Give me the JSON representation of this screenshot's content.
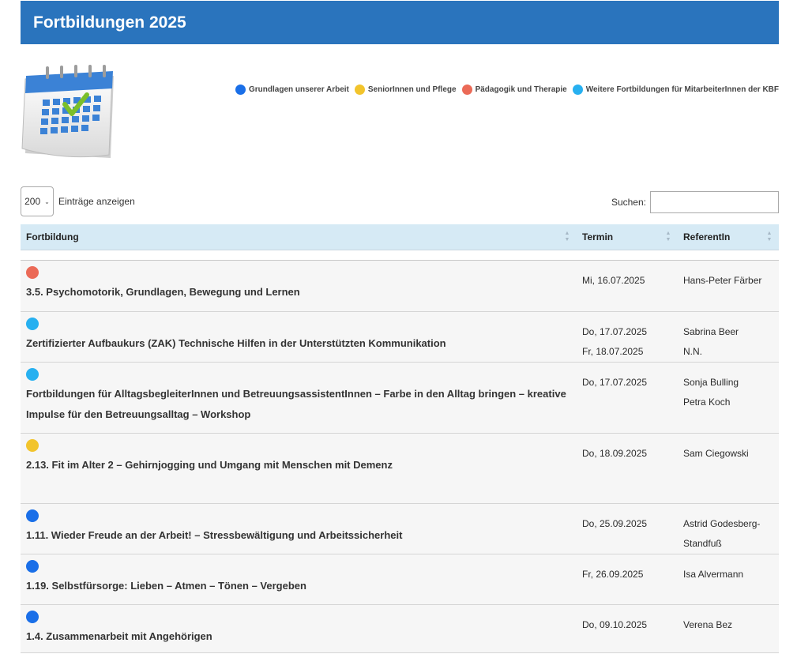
{
  "page_title": "Fortbildungen 2025",
  "legend": [
    {
      "label": "Grundlagen unserer Arbeit",
      "color": "#1a6fe8"
    },
    {
      "label": "SeniorInnen und Pflege",
      "color": "#f2c42c"
    },
    {
      "label": "Pädagogik und Therapie",
      "color": "#eb6a57"
    },
    {
      "label": "Weitere Fortbildungen für MitarbeiterInnen der KBF",
      "color": "#27b0f0"
    }
  ],
  "controls": {
    "page_length_value": "200",
    "page_length_label": "Einträge anzeigen",
    "search_label": "Suchen:",
    "search_value": ""
  },
  "table": {
    "headers": [
      "Fortbildung",
      "Termin",
      "ReferentIn"
    ],
    "rows": [
      {
        "color": "#eb6a57",
        "title": "3.5. Psychomotorik, Grundlagen, Bewegung und Lernen",
        "dates": [
          "Mi, 16.07.2025"
        ],
        "speakers": [
          "Hans-Peter Färber"
        ]
      },
      {
        "color": "#27b0f0",
        "title": "Zertifizierter Aufbaukurs (ZAK) Technische Hilfen in der Unterstützten Kommunikation",
        "dates": [
          "Do, 17.07.2025",
          "Fr, 18.07.2025"
        ],
        "speakers": [
          "Sabrina Beer",
          "N.N."
        ]
      },
      {
        "color": "#27b0f0",
        "title": "Fortbildungen für AlltagsbegleiterInnen und BetreuungsassistentInnen – Farbe in den Alltag bringen – kreative Impulse für den Betreuungsalltag – Workshop",
        "dates": [
          "Do, 17.07.2025"
        ],
        "speakers": [
          "Sonja Bulling",
          "Petra Koch"
        ]
      },
      {
        "color": "#f2c42c",
        "title": "2.13. Fit im Alter 2 – Gehirnjogging und Umgang mit Menschen mit Demenz",
        "dates": [
          "Do, 18.09.2025"
        ],
        "speakers": [
          "Sam Ciegowski"
        ]
      },
      {
        "color": "#1a6fe8",
        "title": "1.11. Wieder Freude an der Arbeit! – Stressbewältigung und Arbeitssicherheit",
        "dates": [
          "Do, 25.09.2025"
        ],
        "speakers": [
          "Astrid Godesberg-",
          "Standfuß"
        ]
      },
      {
        "color": "#1a6fe8",
        "title": "1.19. Selbstfürsorge: Lieben – Atmen – Tönen – Vergeben",
        "dates": [
          "Fr, 26.09.2025"
        ],
        "speakers": [
          "Isa Alvermann"
        ]
      },
      {
        "color": "#1a6fe8",
        "title": "1.4. Zusammenarbeit mit Angehörigen",
        "dates": [
          "Do, 09.10.2025"
        ],
        "speakers": [
          "Verena Bez"
        ]
      }
    ]
  },
  "icons": {
    "calendar": "calendar-check-icon",
    "select_arrow": "chevron-down-icon",
    "sort": "sort-arrows-icon"
  }
}
